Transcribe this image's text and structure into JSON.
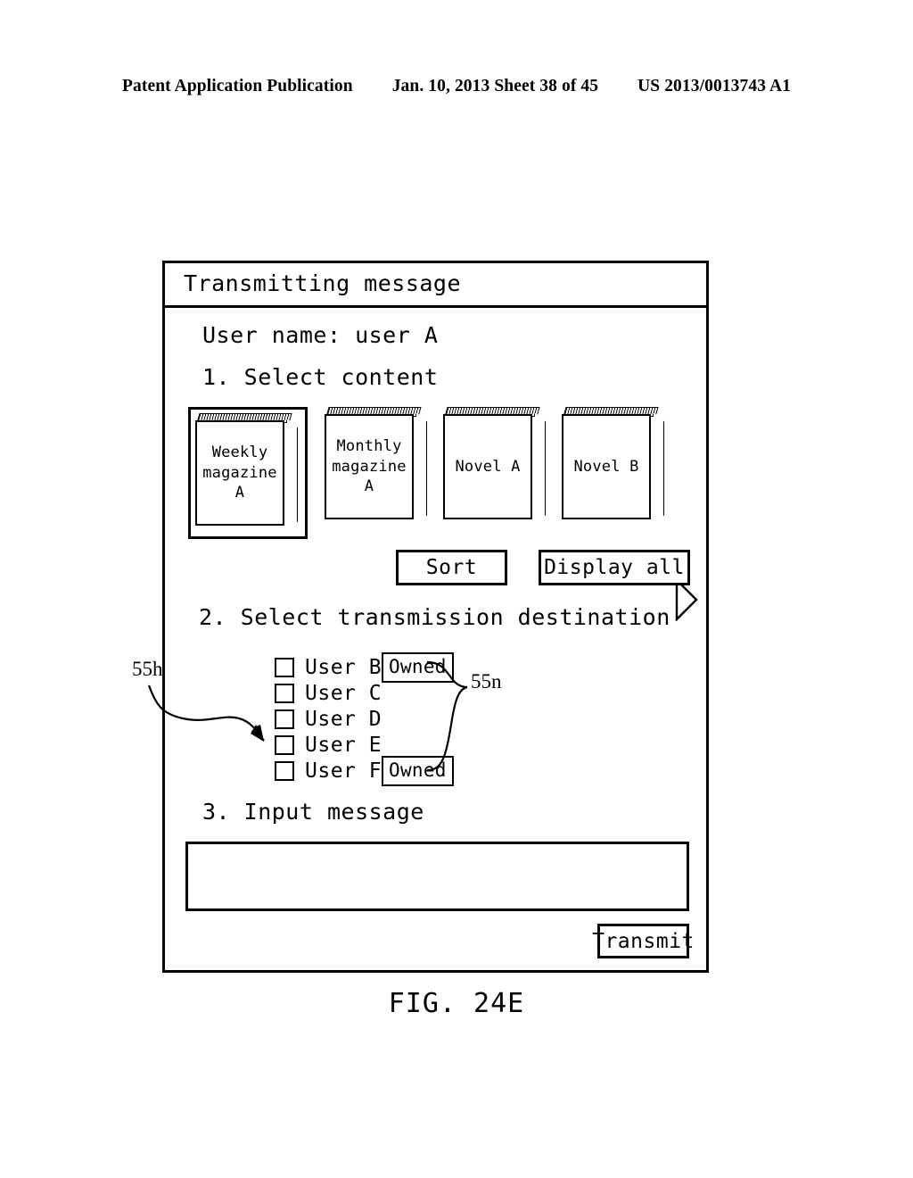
{
  "header": {
    "publication": "Patent Application Publication",
    "date_sheet": "Jan. 10, 2013  Sheet 38 of 45",
    "patent_number": "US 2013/0013743 A1"
  },
  "dialog": {
    "title": "Transmitting message",
    "username_line": "User name: user A",
    "step1_label": "1. Select content",
    "step2_label": "2. Select transmission destination",
    "step3_label": "3. Input message",
    "content_items": [
      {
        "lines": [
          "Weekly",
          "magazine",
          "A"
        ],
        "selected": true
      },
      {
        "lines": [
          "Monthly",
          "magazine",
          "A"
        ],
        "selected": false
      },
      {
        "lines": [
          "Novel A"
        ],
        "selected": false
      },
      {
        "lines": [
          "Novel B"
        ],
        "selected": false
      }
    ],
    "next_arrow_icon": "triangle-right-icon",
    "buttons": {
      "sort": "Sort",
      "display_all": "Display all",
      "transmit": "Transmit"
    },
    "destinations": [
      {
        "label": "User B",
        "checked": false,
        "badge": "Owned"
      },
      {
        "label": "User C",
        "checked": false,
        "badge": ""
      },
      {
        "label": "User D",
        "checked": false,
        "badge": ""
      },
      {
        "label": "User E",
        "checked": false,
        "badge": ""
      },
      {
        "label": "User F",
        "checked": false,
        "badge": "Owned"
      }
    ],
    "message_value": "",
    "message_placeholder": ""
  },
  "callouts": {
    "list_ref": "55h",
    "badge_ref": "55n"
  },
  "figure": {
    "caption": "FIG. 24E"
  },
  "colors": {
    "ink": "#000000",
    "paper": "#ffffff"
  }
}
